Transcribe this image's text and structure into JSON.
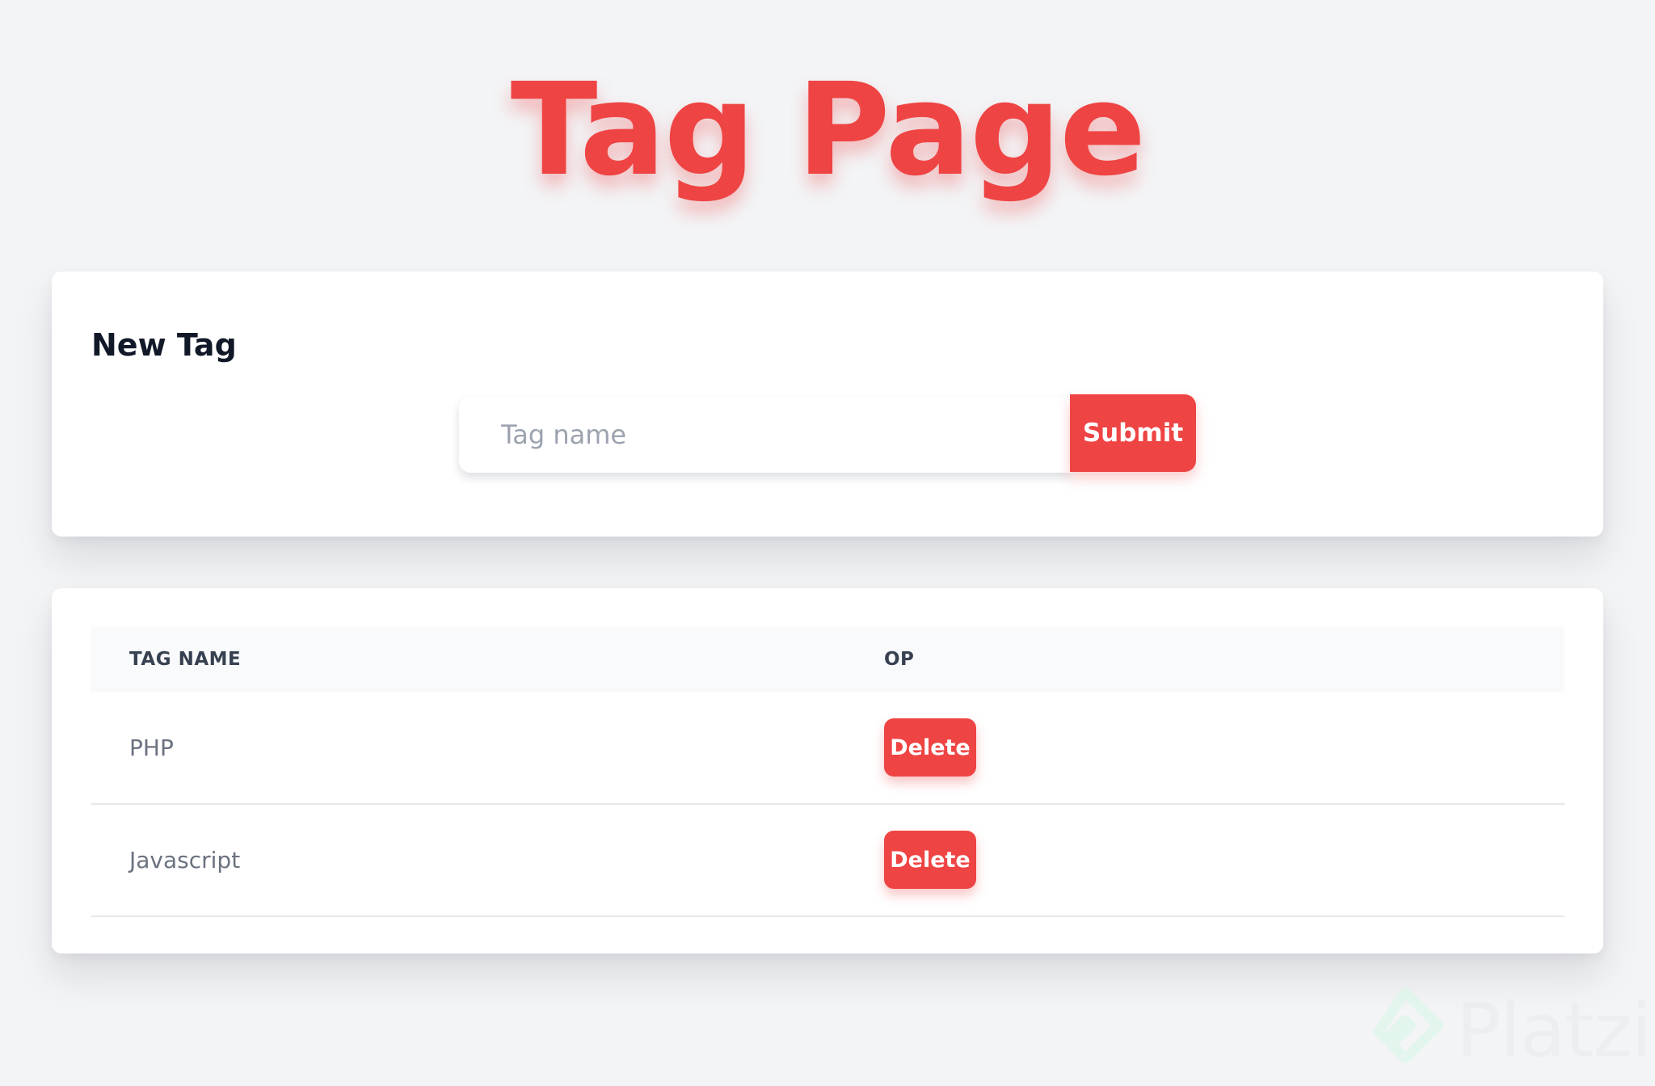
{
  "page": {
    "title": "Tag Page"
  },
  "form": {
    "heading": "New Tag",
    "input_value": "",
    "input_placeholder": "Tag name",
    "submit_label": "Submit"
  },
  "table": {
    "columns": [
      "TAG NAME",
      "OP"
    ],
    "rows": [
      {
        "name": "PHP",
        "action_label": "Delete"
      },
      {
        "name": "Javascript",
        "action_label": "Delete"
      }
    ]
  },
  "watermark": {
    "text": "Platzi"
  },
  "colors": {
    "accent": "#ef4444",
    "background": "#f3f4f6",
    "card": "#ffffff",
    "header_row": "#f9fafb"
  },
  "icons": {
    "watermark_logo": "platzi-logo-icon"
  }
}
